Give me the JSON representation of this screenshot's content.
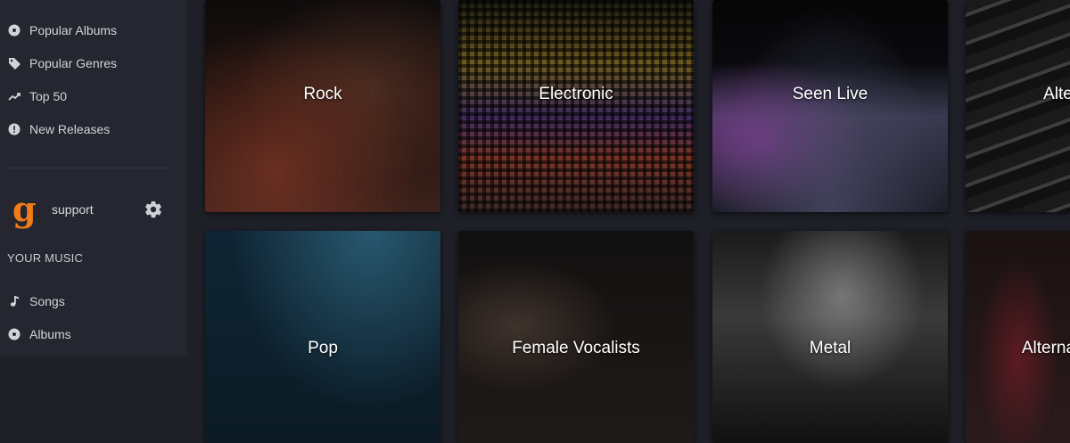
{
  "sidebar": {
    "nav": [
      {
        "label": "Popular Albums",
        "icon": "album-icon"
      },
      {
        "label": "Popular Genres",
        "icon": "tag-icon"
      },
      {
        "label": "Top 50",
        "icon": "trending-icon"
      },
      {
        "label": "New Releases",
        "icon": "alert-icon"
      }
    ],
    "user": {
      "name": "support"
    },
    "your_music_title": "YOUR MUSIC",
    "your_music": [
      {
        "label": "Songs",
        "icon": "music-note-icon"
      },
      {
        "label": "Albums",
        "icon": "album-icon"
      }
    ]
  },
  "genres": [
    {
      "label": "Rock"
    },
    {
      "label": "Electronic"
    },
    {
      "label": "Seen Live"
    },
    {
      "label": "Alternative"
    },
    {
      "label": "Pop"
    },
    {
      "label": "Female Vocalists"
    },
    {
      "label": "Metal"
    },
    {
      "label": "Alternative Rock"
    }
  ],
  "colors": {
    "brand": "#f07c1a",
    "background": "#1e1f27",
    "sidebar": "#25262f"
  }
}
